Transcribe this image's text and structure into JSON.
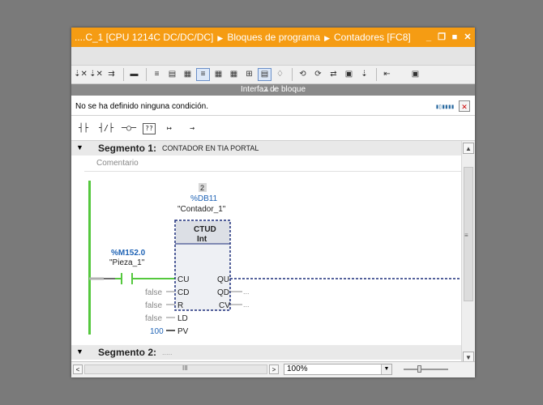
{
  "window": {
    "breadcrumb": [
      "....C_1 [CPU 1214C DC/DC/DC]",
      "Bloques de programa",
      "Contadores [FC8]"
    ],
    "controls": [
      "_",
      "❐",
      "■",
      "✕"
    ]
  },
  "toolbar": {
    "icons": [
      "⇣✕",
      "⇣✕",
      "⇉",
      "▬",
      "≡",
      "▤",
      "▦",
      "≡",
      "▦",
      "▦",
      "⊞",
      "▤",
      "♢",
      "⟲",
      "⟳",
      "⇄",
      "▣",
      "⇣",
      "⇤",
      "▣"
    ]
  },
  "interface_bar": {
    "label": "Interfaz de bloque",
    "handles": "▲ ▼"
  },
  "condition": {
    "text": "No se ha definido ninguna condición.",
    "indicator": "▮▯▮▮▮▮",
    "close_glyph": "✕"
  },
  "ladder_toolbar": [
    "┤├",
    "┤/├",
    "─○─",
    "??",
    "↦",
    "→"
  ],
  "segments": [
    {
      "arrow": "▼",
      "label": "Segmento 1:",
      "title": "CONTADOR EN TIA PORTAL",
      "comment": "Comentario"
    },
    {
      "arrow": "▼",
      "label": "Segmento 2:",
      "title": "....."
    }
  ],
  "contact": {
    "address": "%M152.0",
    "tag": "\"Pieza_1\""
  },
  "counter": {
    "instance_no": "2",
    "db": "%DB11",
    "db_name": "\"Contador_1\"",
    "type": "CTUD",
    "datatype": "Int",
    "inputs": [
      {
        "value": "",
        "pin": "CU"
      },
      {
        "value": "false",
        "pin": "CD"
      },
      {
        "value": "false",
        "pin": "R"
      },
      {
        "value": "false",
        "pin": "LD"
      },
      {
        "value": "100",
        "pin": "PV"
      }
    ],
    "outputs": [
      {
        "pin": "QU",
        "value": ""
      },
      {
        "pin": "QD",
        "value": "..."
      },
      {
        "pin": "CV",
        "value": "..."
      }
    ]
  },
  "statusbar": {
    "zoom": "100%",
    "left_arrow": "<",
    "right_arrow": ">",
    "dd": "▼",
    "hgrip": "III"
  },
  "scroll": {
    "up": "▲",
    "down": "▼",
    "grip": "≡"
  },
  "colors": {
    "title": "#f59c13",
    "rail": "#55c83e",
    "address": "#1f63b5",
    "box_border": "#1b2d7a",
    "wire": "#222"
  }
}
